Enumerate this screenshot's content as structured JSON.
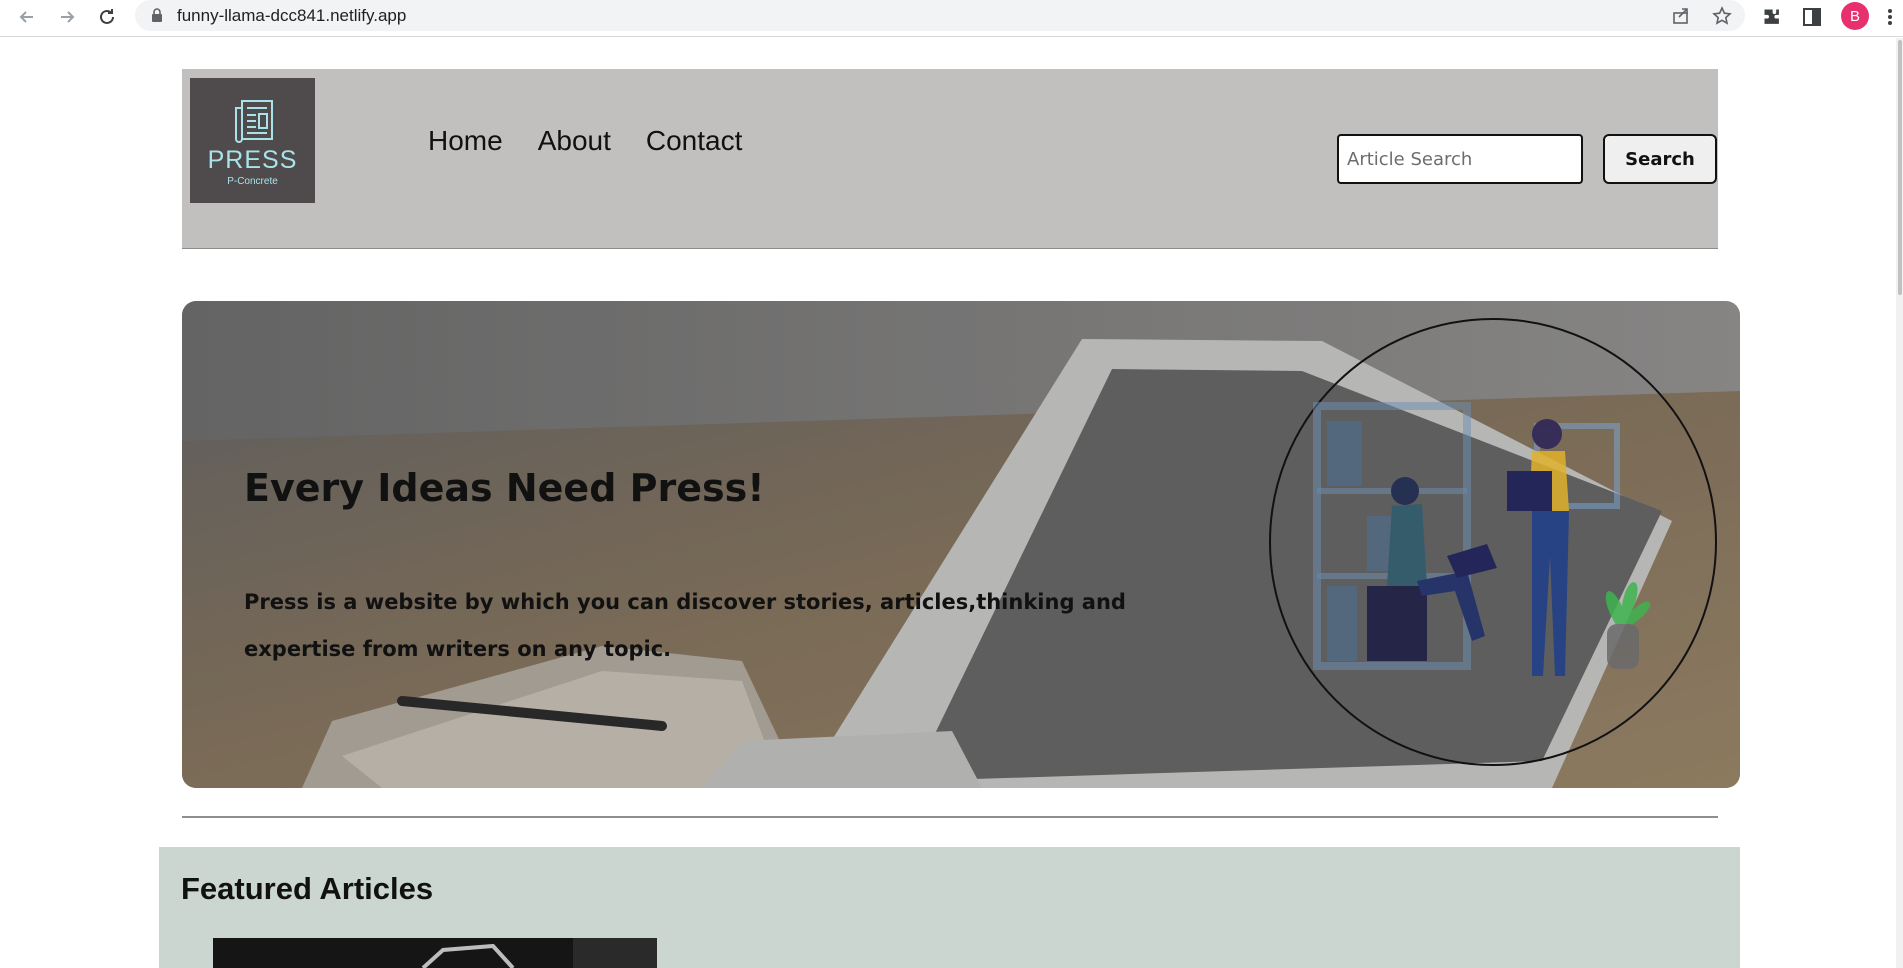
{
  "browser": {
    "url": "funny-llama-dcc841.netlify.app",
    "profile_initial": "B"
  },
  "header": {
    "logo_text": "PRESS",
    "logo_subtext": "P-Concrete",
    "nav": [
      "Home",
      "About",
      "Contact"
    ],
    "search_placeholder": "Article Search",
    "search_button": "Search"
  },
  "hero": {
    "title": "Every Ideas Need Press!",
    "text": "Press is a website by which you can discover stories, articles,thinking and expertise from writers on any topic."
  },
  "featured": {
    "title": "Featured Articles"
  },
  "colors": {
    "header_bg": "#c1c0be",
    "logo_bg": "#4f4a4b",
    "logo_accent": "#a8e3ea",
    "featured_bg": "#cbd6d0",
    "profile": "#e8306e"
  }
}
